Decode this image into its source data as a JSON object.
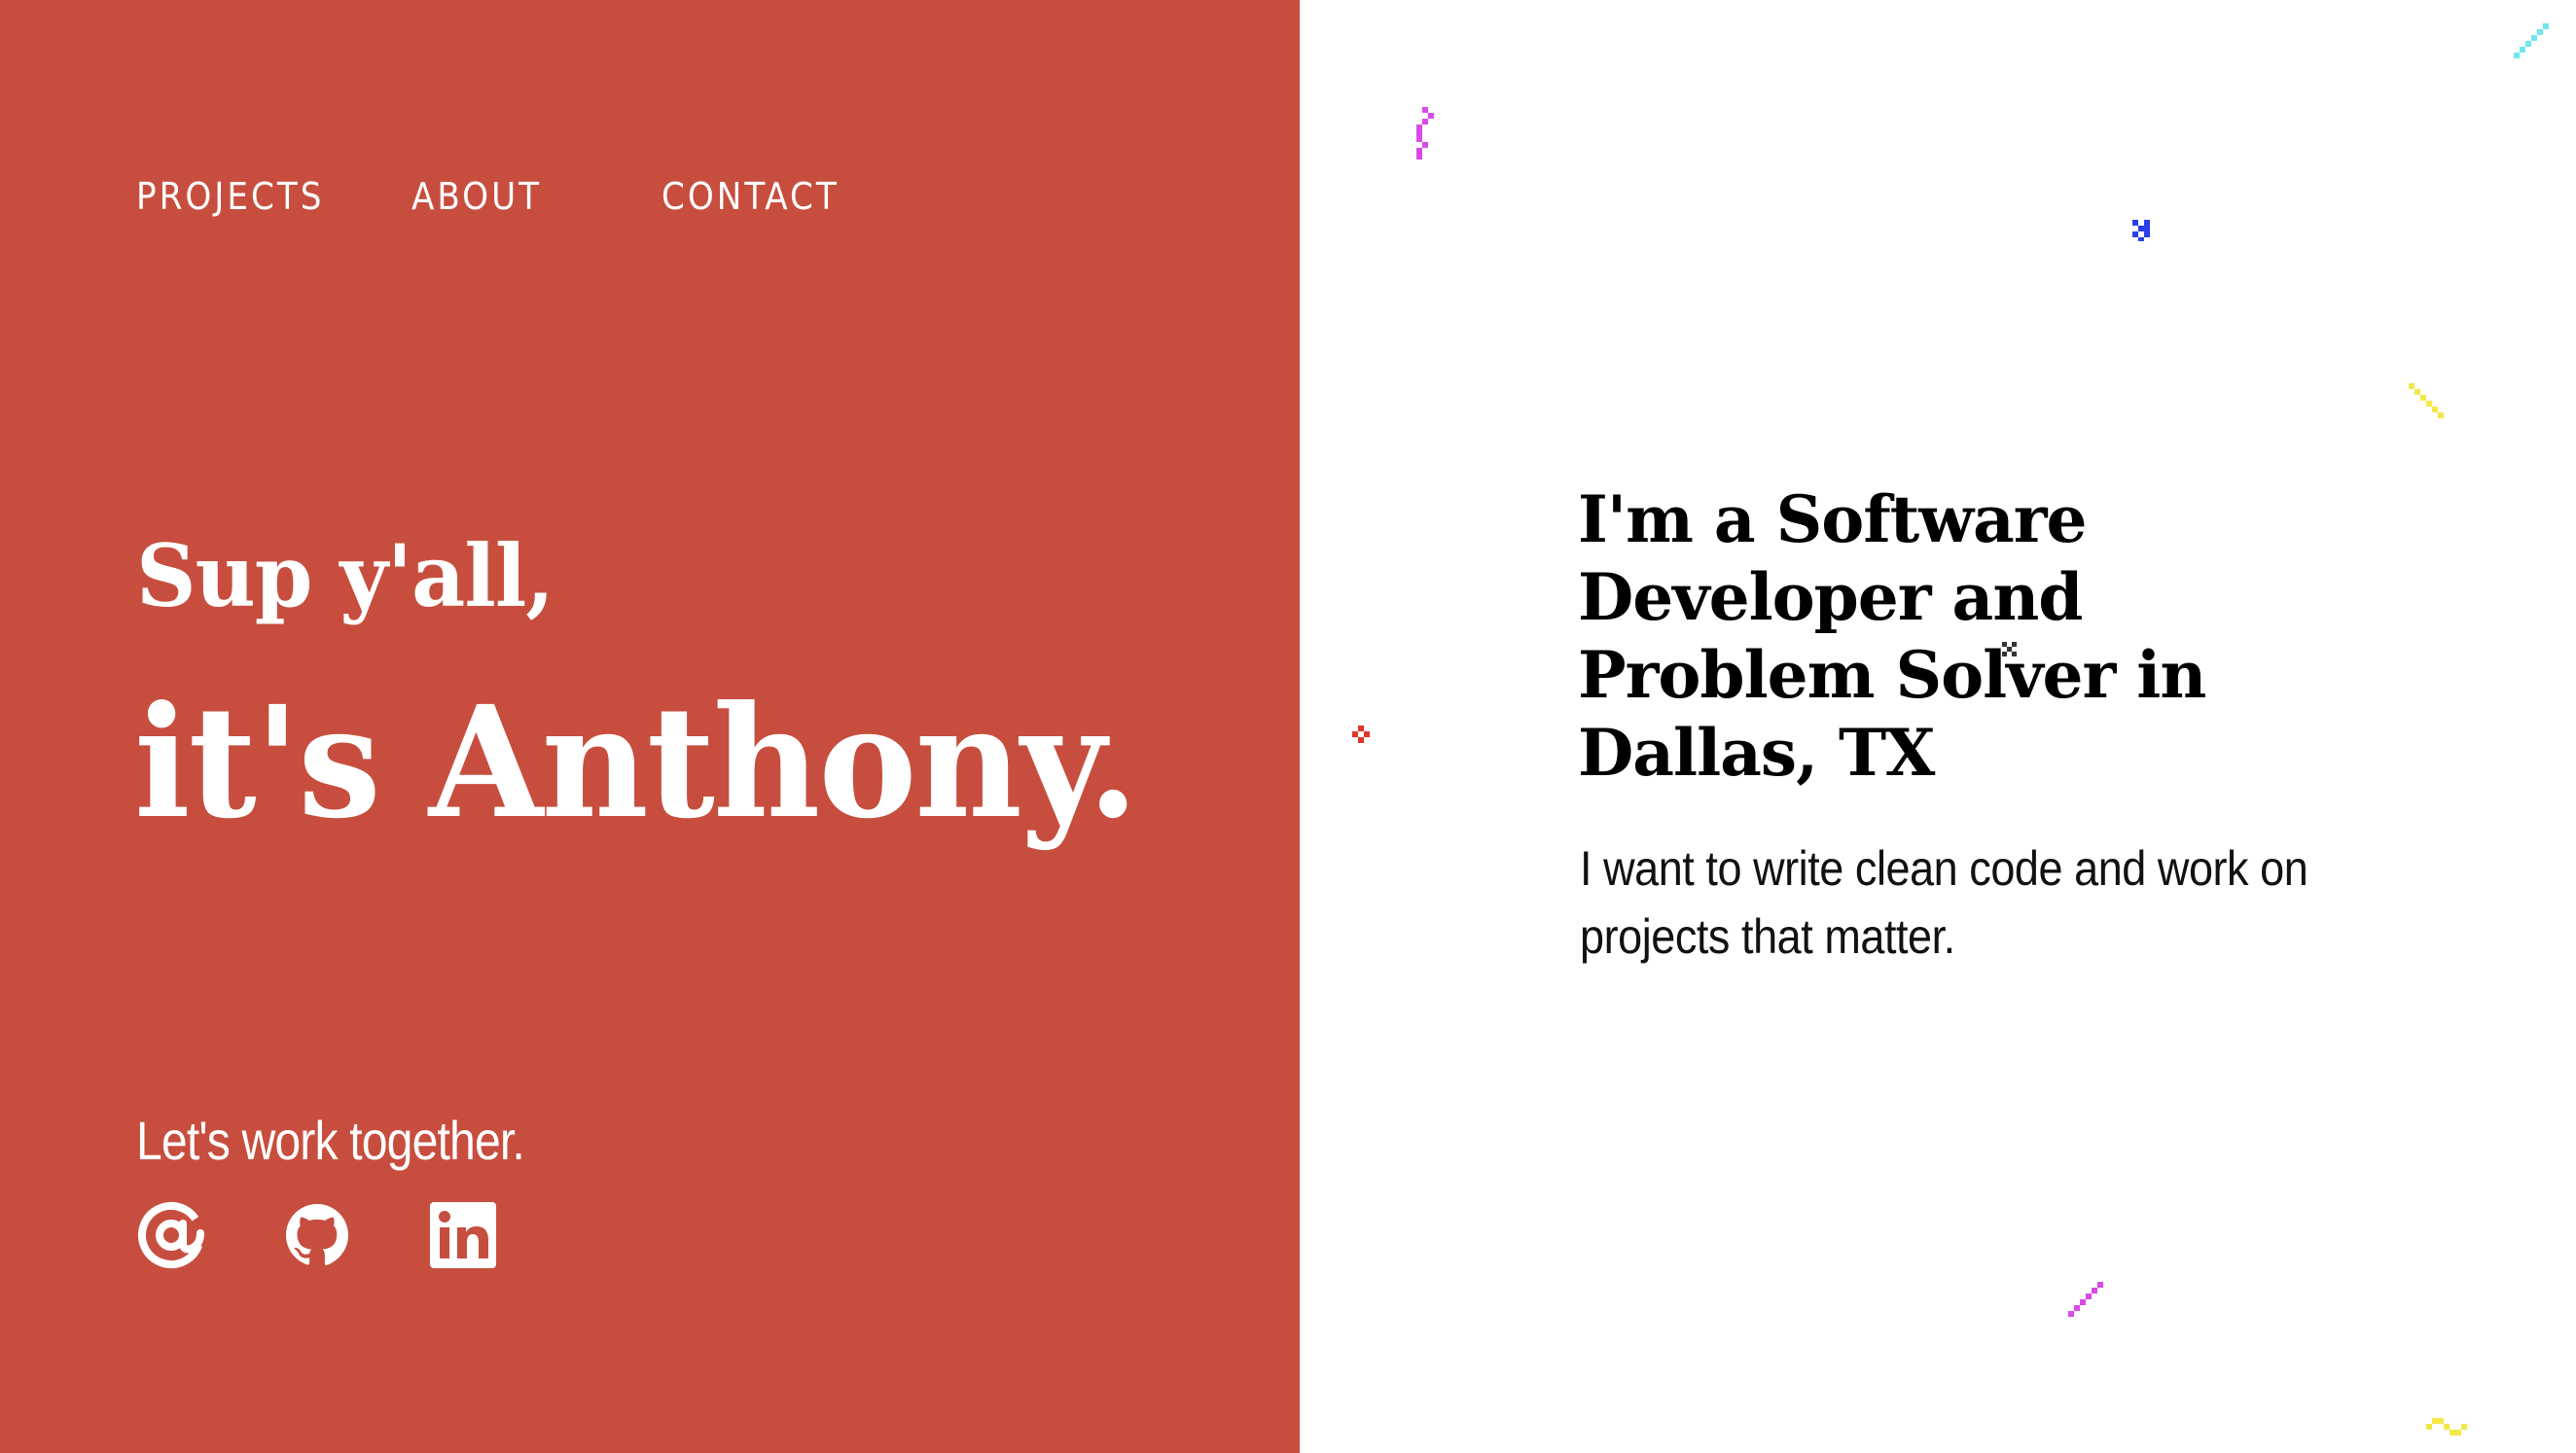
{
  "nav": {
    "projects": "PROJECTS",
    "about": "ABOUT",
    "contact": "CONTACT"
  },
  "hero": {
    "greeting": "Sup y'all,",
    "name": "it's Anthony.",
    "cta": "Let's work together."
  },
  "socials": [
    {
      "icon": "at-icon",
      "label": "Email"
    },
    {
      "icon": "github-icon",
      "label": "GitHub"
    },
    {
      "icon": "linkedin-icon",
      "label": "LinkedIn"
    }
  ],
  "about": {
    "headline": "I'm a Software Developer and Problem Solver in Dallas, TX",
    "subtext": "I want to write clean code and work on projects that matter."
  },
  "colors": {
    "accent": "#c74e3e",
    "text_light": "#ffffff",
    "text_dark": "#000000"
  }
}
